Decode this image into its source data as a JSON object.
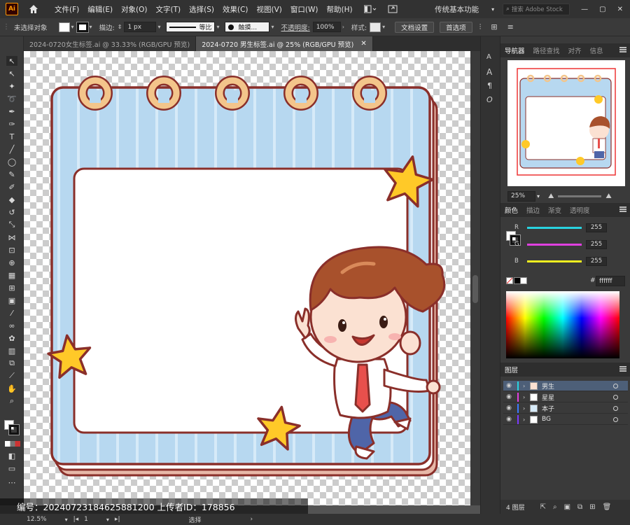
{
  "app": {
    "logo_text": "Ai"
  },
  "menu": {
    "items": [
      "文件(F)",
      "编辑(E)",
      "对象(O)",
      "文字(T)",
      "选择(S)",
      "效果(C)",
      "视图(V)",
      "窗口(W)",
      "帮助(H)"
    ],
    "workspace": "传统基本功能",
    "stock_placeholder": "搜索 Adobe Stock"
  },
  "control": {
    "selection": "未选择对象",
    "stroke_label": "描边:",
    "stroke_width": "1 px",
    "stroke_profile": "等比",
    "brush": "触摸...",
    "opacity_label": "不透明度:",
    "opacity_value": "100%",
    "style_label": "样式:",
    "doc_setup": "文档设置",
    "preferences": "首选项"
  },
  "tabs": [
    {
      "label": "2024-0720女生标签.ai @ 33.33% (RGB/GPU 预览)",
      "active": false
    },
    {
      "label": "2024-0720 男生标签.ai @ 25% (RGB/GPU 预览)",
      "active": true
    }
  ],
  "artwork": {
    "colors": {
      "paper_blue": "#b7d8f0",
      "stripe": "#d6eaf8",
      "outline": "#8a2f2a",
      "star": "#ffc928",
      "ring": "#f3c58b",
      "hair": "#a8512c",
      "tie": "#e8504c",
      "pants": "#4f65a8"
    }
  },
  "navigator": {
    "tabs": [
      "导航器",
      "路径查找",
      "对齐",
      "信息"
    ],
    "zoom": "25%"
  },
  "color_panel": {
    "tabs": [
      "颜色",
      "描边",
      "渐变",
      "透明度"
    ],
    "channels": [
      {
        "label": "R",
        "value": "255",
        "color": "#29d3e0"
      },
      {
        "label": "G",
        "value": "255",
        "color": "#e040e0"
      },
      {
        "label": "B",
        "value": "255",
        "color": "#f0f020"
      }
    ],
    "hex": "ffffff"
  },
  "layers": {
    "tab": "图层",
    "items": [
      {
        "name": "男生",
        "color": "#29d3e0",
        "selected": true
      },
      {
        "name": "星星",
        "color": "#e040e0",
        "selected": false
      },
      {
        "name": "本子",
        "color": "#3a7bff",
        "selected": false
      },
      {
        "name": "BG",
        "color": "#7c3aff",
        "selected": false
      }
    ],
    "count_label": "4 图层"
  },
  "status": {
    "zoom": "12.5%",
    "artboard": "1",
    "tool": "选择"
  },
  "watermark": {
    "text": "编号：20240723184625881200   上传者ID：178856"
  }
}
